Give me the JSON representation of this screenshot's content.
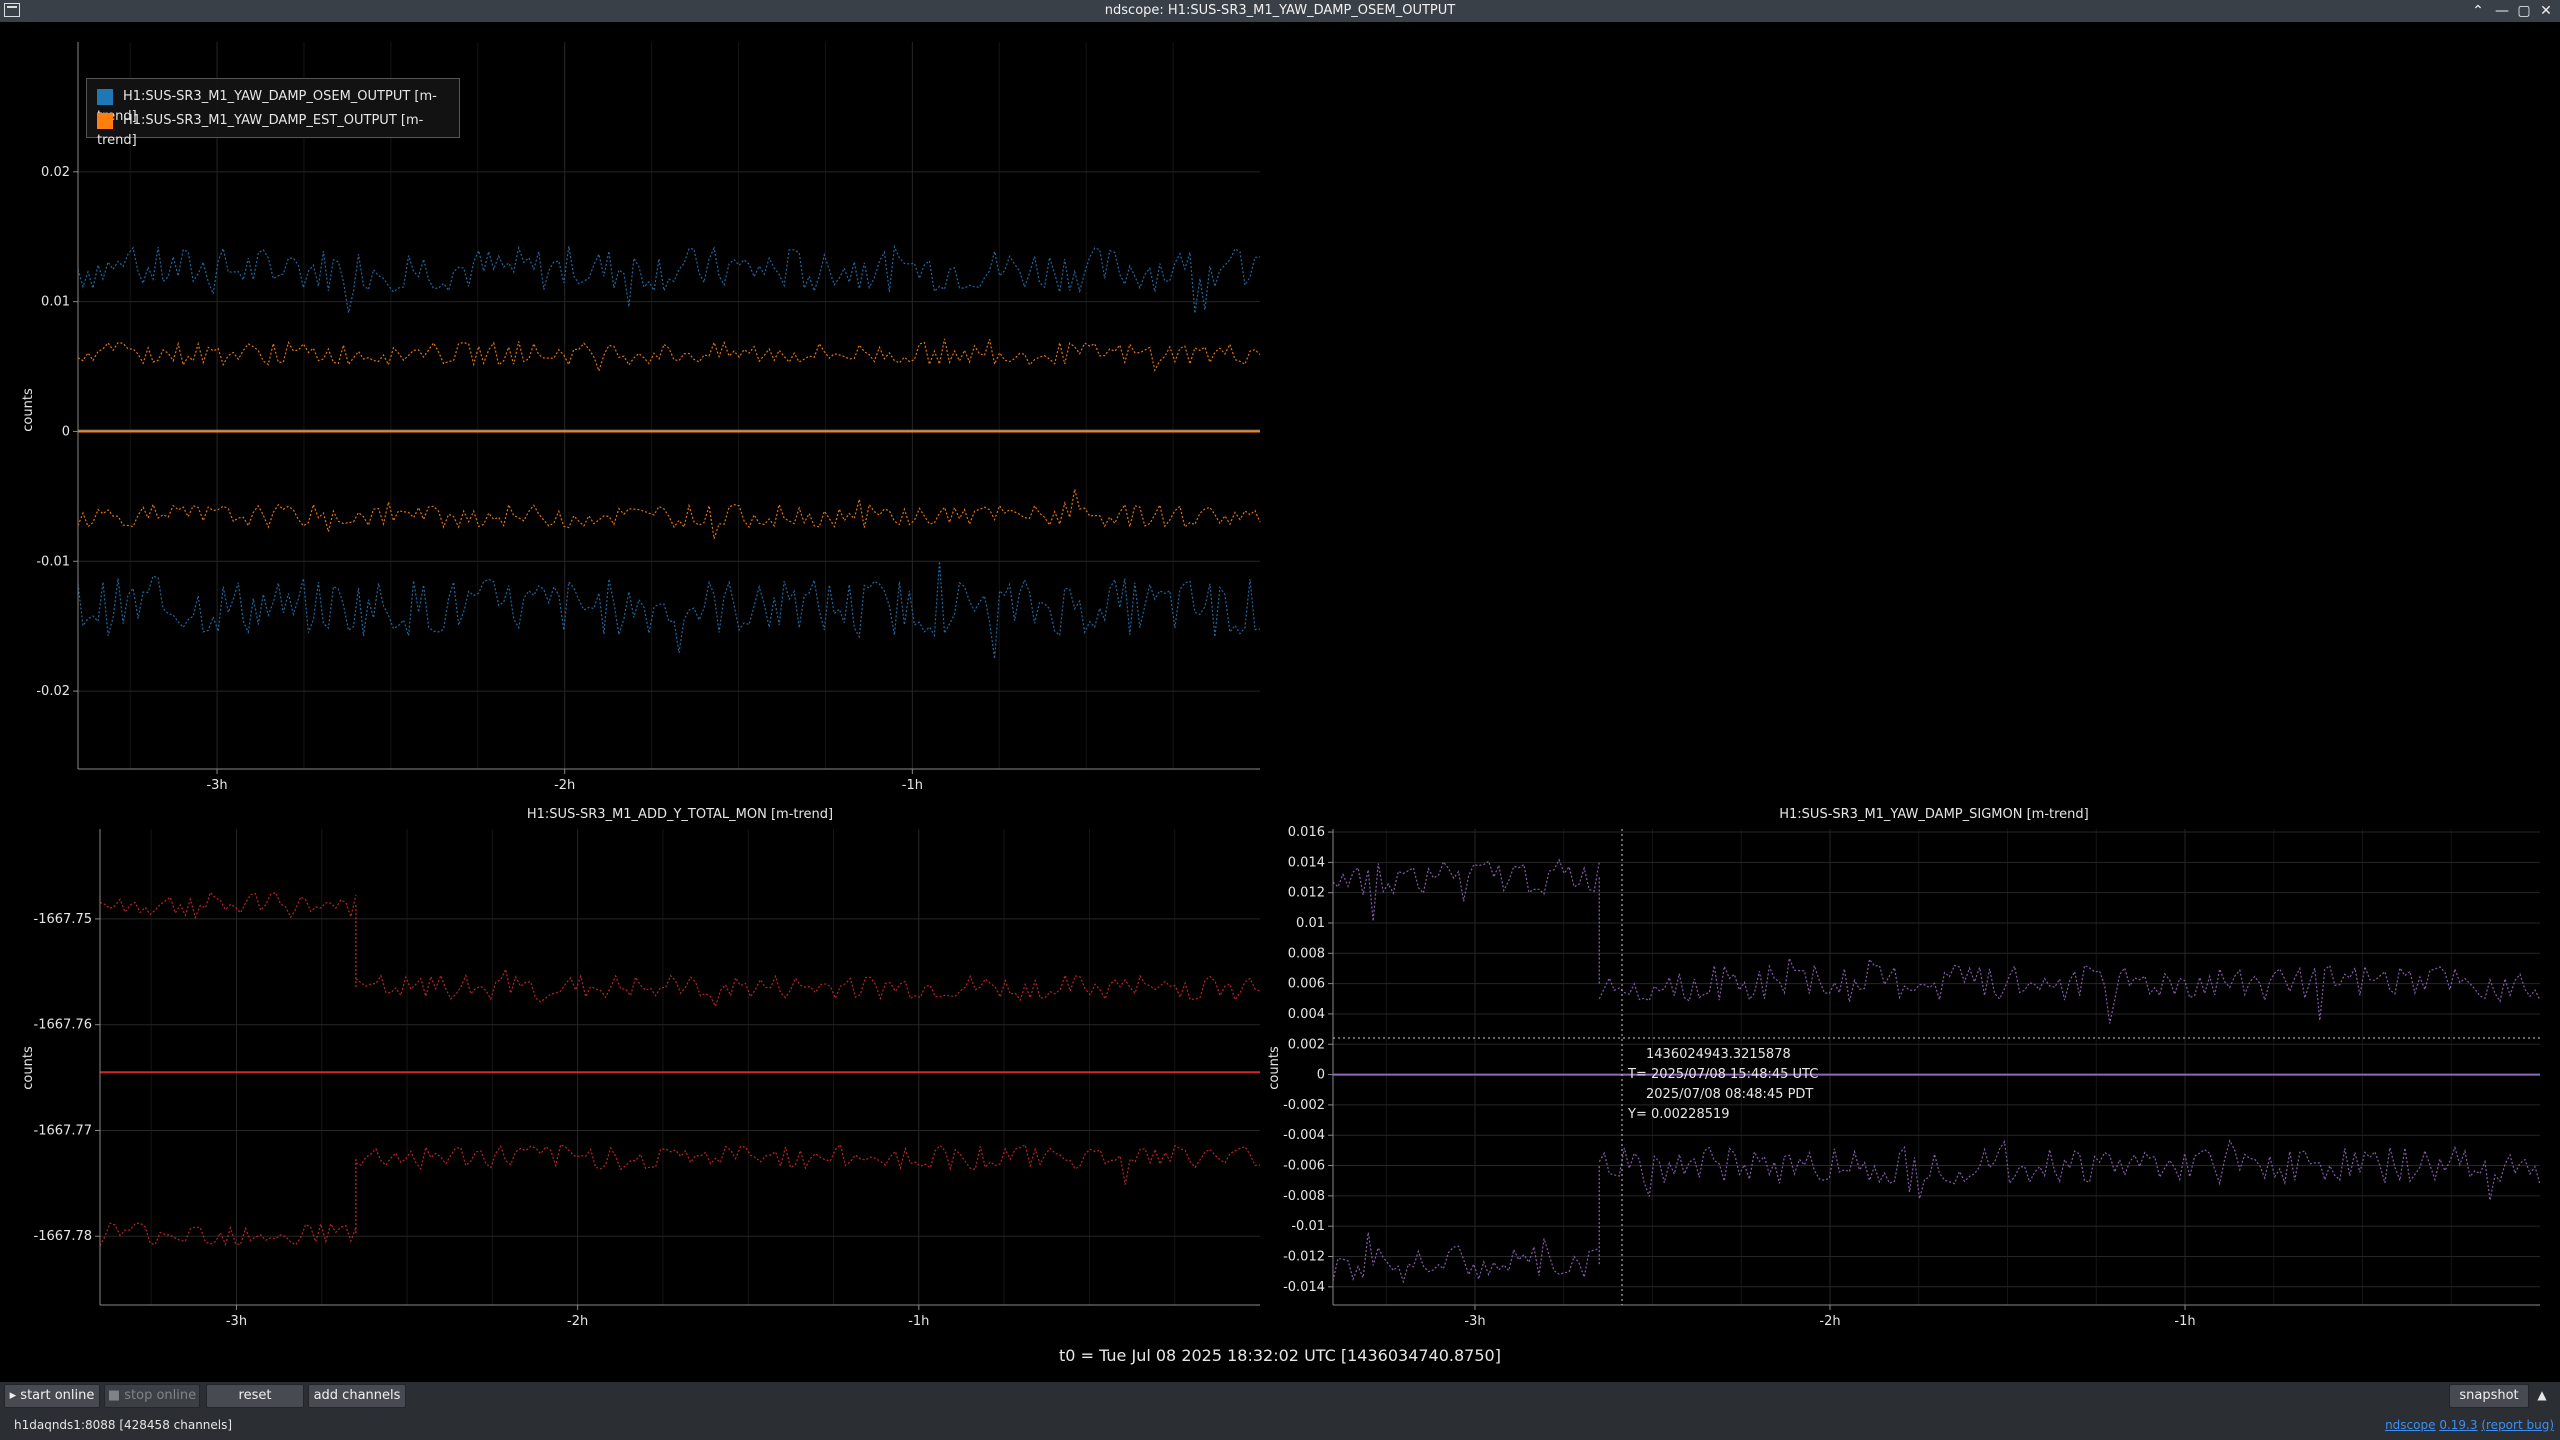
{
  "window": {
    "title": "ndscope: H1:SUS-SR3_M1_YAW_DAMP_OSEM_OUTPUT",
    "minimize": "—",
    "maximize": "▢",
    "close": "✕",
    "roll": "⌃"
  },
  "colors": {
    "osem": "#1f77b4",
    "est": "#ff7f0e",
    "add": "#d62728",
    "sigmon": "#9467bd",
    "background": "#000000",
    "grid": "#2a2a2a"
  },
  "plots": [
    {
      "id": "top",
      "title": "",
      "ylabel": "counts",
      "yticks": [
        "0.02",
        "0.01",
        "0",
        "-0.01",
        "-0.02"
      ],
      "xticks": [
        "-3h",
        "-2h",
        "-1h"
      ]
    },
    {
      "id": "bottom-left",
      "title": "H1:SUS-SR3_M1_ADD_Y_TOTAL_MON [m-trend]",
      "ylabel": "counts",
      "yticks": [
        "-1667.75",
        "-1667.76",
        "-1667.77",
        "-1667.78"
      ],
      "xticks": [
        "-3h",
        "-2h",
        "-1h"
      ]
    },
    {
      "id": "bottom-right",
      "title": "H1:SUS-SR3_M1_YAW_DAMP_SIGMON [m-trend]",
      "ylabel": "counts",
      "yticks": [
        "0.016",
        "0.014",
        "0.012",
        "0.01",
        "0.008",
        "0.006",
        "0.004",
        "0.002",
        "0",
        "-0.002",
        "-0.004",
        "-0.006",
        "-0.008",
        "-0.01",
        "-0.012",
        "-0.014"
      ],
      "xticks": [
        "-3h",
        "-2h",
        "-1h"
      ]
    }
  ],
  "legend": [
    {
      "label": "H1:SUS-SR3_M1_YAW_DAMP_OSEM_OUTPUT [m-trend]",
      "color": "#1f77b4"
    },
    {
      "label": "H1:SUS-SR3_M1_YAW_DAMP_EST_OUTPUT [m-trend]",
      "color": "#ff7f0e"
    }
  ],
  "cursor": {
    "gps": "1436024943.3215878",
    "t_utc": "T= 2025/07/08 15:48:45 UTC",
    "t_pdt": "2025/07/08 08:48:45 PDT",
    "y": "Y= 0.00228519"
  },
  "t0": "t0 = Tue Jul 08 2025 18:32:02 UTC [1436034740.8750]",
  "buttons": {
    "start_online": "start online",
    "stop_online": "stop online",
    "reset": "reset",
    "add_channels": "add channels",
    "snapshot": "snapshot"
  },
  "status": {
    "server": "h1daqnds1:8088  [428458 channels]",
    "version_prefix": "ndscope",
    "version": "0.19.3",
    "report": "(report bug)"
  },
  "chart_data": [
    {
      "type": "line",
      "title": "",
      "xlabel": "",
      "ylabel": "counts",
      "xlim": [
        "-3.4h",
        "0h"
      ],
      "ylim": [
        -0.026,
        0.03
      ],
      "grid": true,
      "legend_position": "top-left",
      "series": [
        {
          "name": "H1:SUS-SR3_M1_YAW_DAMP_OSEM_OUTPUT [m-trend]",
          "stat": "max",
          "mean": 0.0125,
          "range": [
            0.0105,
            0.0175
          ]
        },
        {
          "name": "H1:SUS-SR3_M1_YAW_DAMP_OSEM_OUTPUT [m-trend]",
          "stat": "mean",
          "mean": 0.0
        },
        {
          "name": "H1:SUS-SR3_M1_YAW_DAMP_OSEM_OUTPUT [m-trend]",
          "stat": "min",
          "mean": -0.0135,
          "range": [
            -0.0195,
            -0.0105
          ]
        },
        {
          "name": "H1:SUS-SR3_M1_YAW_DAMP_EST_OUTPUT [m-trend]",
          "stat": "max",
          "mean": 0.006,
          "range": [
            0.005,
            0.0085
          ]
        },
        {
          "name": "H1:SUS-SR3_M1_YAW_DAMP_EST_OUTPUT [m-trend]",
          "stat": "mean",
          "mean": 0.0
        },
        {
          "name": "H1:SUS-SR3_M1_YAW_DAMP_EST_OUTPUT [m-trend]",
          "stat": "min",
          "mean": -0.0065,
          "range": [
            -0.0085,
            -0.005
          ]
        }
      ]
    },
    {
      "type": "line",
      "title": "H1:SUS-SR3_M1_ADD_Y_TOTAL_MON [m-trend]",
      "xlabel": "",
      "ylabel": "counts",
      "xlim": [
        "-3.4h",
        "0h"
      ],
      "ylim": [
        -1667.7865,
        -1667.7415
      ],
      "grid": true,
      "series": [
        {
          "name": "max",
          "segments": [
            {
              "x": [
                "-3.4h",
                "-2.65h"
              ],
              "mean": -1667.7487
            },
            {
              "x": [
                "-2.65h",
                "0h"
              ],
              "mean": -1667.7565
            }
          ]
        },
        {
          "name": "mean",
          "mean": -1667.7645
        },
        {
          "name": "min",
          "segments": [
            {
              "x": [
                "-3.4h",
                "-2.65h"
              ],
              "mean": -1667.7797
            },
            {
              "x": [
                "-2.65h",
                "0h"
              ],
              "mean": -1667.7725
            }
          ]
        }
      ]
    },
    {
      "type": "line",
      "title": "H1:SUS-SR3_M1_YAW_DAMP_SIGMON [m-trend]",
      "xlabel": "",
      "ylabel": "counts",
      "xlim": [
        "-3.4h",
        "0h"
      ],
      "ylim": [
        -0.0152,
        0.0162
      ],
      "grid": true,
      "series": [
        {
          "name": "max",
          "segments": [
            {
              "x": [
                "-3.4h",
                "-2.65h"
              ],
              "mean": 0.013
            },
            {
              "x": [
                "-2.65h",
                "0h"
              ],
              "mean": 0.006
            }
          ]
        },
        {
          "name": "mean",
          "mean": 0.0
        },
        {
          "name": "min",
          "segments": [
            {
              "x": [
                "-3.4h",
                "-2.65h"
              ],
              "mean": -0.0125
            },
            {
              "x": [
                "-2.65h",
                "0h"
              ],
              "mean": -0.006
            }
          ]
        }
      ]
    }
  ]
}
